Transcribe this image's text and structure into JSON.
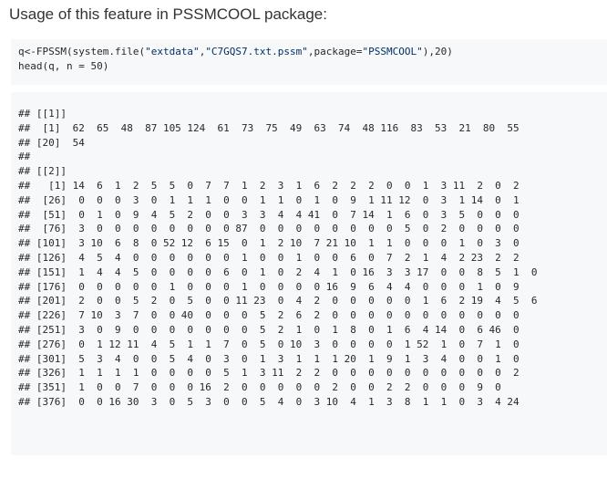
{
  "heading": "Usage of this feature in PSSMCOOL package:",
  "code": {
    "line1": {
      "pre": "q<-FPSSM(system.file(",
      "str1": "\"extdata\"",
      "sep1": ",",
      "str2": "\"C7GQS7.txt.pssm\"",
      "sep2": ",package=",
      "str3": "\"PSSMCOOL\"",
      "post": "),20)"
    },
    "line2": "head(q, n = 50)"
  },
  "output_lines": [
    "## [[1]]",
    "##  [1]  62  65  48  87 105 124  61  73  75  49  63  74  48 116  83  53  21  80  55",
    "## [20]  54",
    "##",
    "## [[2]]",
    "##   [1] 14  6  1  2  5  5  0  7  7  1  2  3  1  6  2  2  2  0  0  1  3 11  2  0  2",
    "##  [26]  0  0  0  3  0  1  1  1  0  0  1  1  0  1  0  9  1 11 12  0  3  1 14  0  1",
    "##  [51]  0  1  0  9  4  5  2  0  0  3  3  4  4 41  0  7 14  1  6  0  3  5  0  0  0",
    "##  [76]  3  0  0  0  0  0  0  0  0 87  0  0  0  0  0  0  0  0  5  0  2  0  0  0  0",
    "## [101]  3 10  6  8  0 52 12  6 15  0  1  2 10  7 21 10  1  1  0  0  0  1  0  3  0",
    "## [126]  4  5  4  0  0  0  0  0  0  1  0  0  1  0  0  6  0  7  2  1  4  2 23  2  2",
    "## [151]  1  4  4  5  0  0  0  0  6  0  1  0  2  4  1  0 16  3  3 17  0  0  8  5  1  0",
    "## [176]  0  0  0  0  0  1  0  0  0  1  0  0  0  0 16  9  6  4  4  0  0  0  1  0  9",
    "## [201]  2  0  0  5  2  0  5  0  0 11 23  0  4  2  0  0  0  0  0  1  6  2 19  4  5  6",
    "## [226]  7 10  3  7  0  0 40  0  0  0  5  2  6  2  0  0  0  0  0  0  0  0  0  0  0",
    "## [251]  3  0  9  0  0  0  0  0  0  0  5  2  1  0  1  8  0  1  6  4 14  0  6 46  0",
    "## [276]  0  1 12 11  4  5  1  1  7  0  5  0 10  3  0  0  0  0  1 52  1  0  7  1  0",
    "## [301]  5  3  4  0  0  5  4  0  3  0  1  3  1  1  1 20  1  9  1  3  4  0  0  1  0",
    "## [326]  1  1  1  1  0  0  0  0  5  1  3 11  2  2  0  0  0  0  0  0  0  0  0  0  2",
    "## [351]  1  0  0  7  0  0  0 16  2  0  0  0  0  0  2  0  0  2  2  0  0  0  9  0",
    "## [376]  0  0 16 30  3  0  5  3  0  0  5  4  0  3 10  4  1  3  8  1  1  0  3  4 24"
  ]
}
